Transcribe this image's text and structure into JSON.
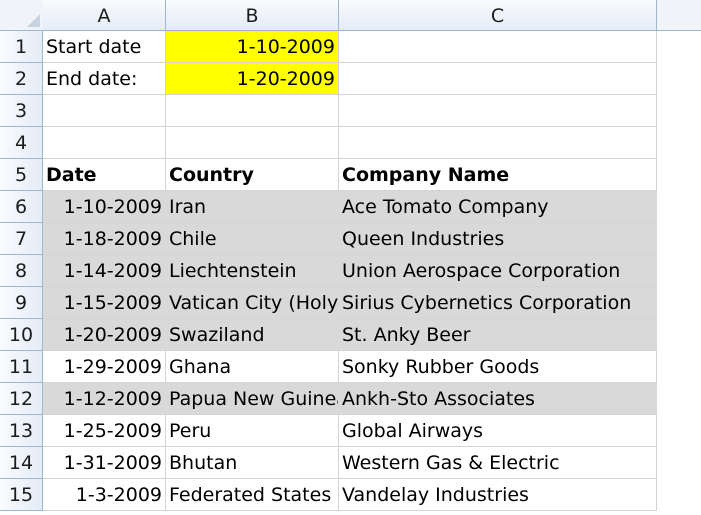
{
  "columns": [
    "A",
    "B",
    "C"
  ],
  "rows": [
    {
      "num": "1",
      "a": "Start date",
      "b": "1-10-2009",
      "c": ""
    },
    {
      "num": "2",
      "a": "End date:",
      "b": "1-20-2009",
      "c": ""
    },
    {
      "num": "3",
      "a": "",
      "b": "",
      "c": ""
    },
    {
      "num": "4",
      "a": "",
      "b": "",
      "c": ""
    },
    {
      "num": "5",
      "a": "Date",
      "b": "Country",
      "c": "Company Name"
    },
    {
      "num": "6",
      "a": "1-10-2009",
      "b": "Iran",
      "c": "Ace Tomato Company"
    },
    {
      "num": "7",
      "a": "1-18-2009",
      "b": "Chile",
      "c": "Queen Industries"
    },
    {
      "num": "8",
      "a": "1-14-2009",
      "b": "Liechtenstein",
      "c": "Union Aerospace Corporation"
    },
    {
      "num": "9",
      "a": "1-15-2009",
      "b": "Vatican City (Holy See)",
      "c": "Sirius Cybernetics Corporation"
    },
    {
      "num": "10",
      "a": "1-20-2009",
      "b": "Swaziland",
      "c": "St. Anky Beer"
    },
    {
      "num": "11",
      "a": "1-29-2009",
      "b": "Ghana",
      "c": "Sonky Rubber Goods"
    },
    {
      "num": "12",
      "a": "1-12-2009",
      "b": "Papua New Guinea",
      "c": "Ankh-Sto Associates"
    },
    {
      "num": "13",
      "a": "1-25-2009",
      "b": "Peru",
      "c": "Global Airways"
    },
    {
      "num": "14",
      "a": "1-31-2009",
      "b": "Bhutan",
      "c": "Western Gas & Electric"
    },
    {
      "num": "15",
      "a": "1-3-2009",
      "b": "Federated States of Micronesia",
      "c": "Vandelay Industries"
    }
  ],
  "highlight_colors": {
    "input_cells": "#ffff00",
    "matching_rows": "#d9d9d9"
  }
}
